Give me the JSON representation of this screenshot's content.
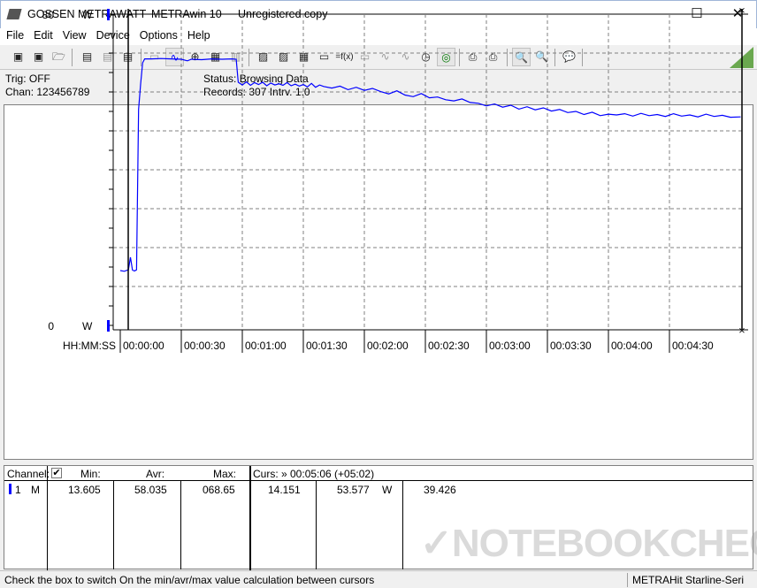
{
  "window": {
    "title_brand": "GOSSEN METRAWATT",
    "title_app": "METRAwin 10",
    "title_note": "Unregistered copy",
    "minimize": "—",
    "maximize": "☐",
    "close": "✕"
  },
  "menu": [
    "File",
    "Edit",
    "View",
    "Device",
    "Options",
    "Help"
  ],
  "toolbar": {
    "icons": [
      "save-export-icon",
      "save-icon",
      "open-folder-icon",
      "read-memory-icon",
      "read-memory-disabled-icon",
      "read-m-icon",
      "display-1257-icon",
      "waveform-icon",
      "crosshair-icon",
      "table-icon",
      "bar-graph-icon",
      "export-icon",
      "import-icon",
      "channel-config-icon",
      "monitor-icon",
      "function-icon",
      "send-icon",
      "trigger-icon",
      "sweep-icon",
      "clock-icon",
      "timer-icon",
      "print-preview-icon",
      "print-icon",
      "zoom-wave-icon",
      "zoom-icon",
      "comment-icon"
    ]
  },
  "info": {
    "trig": "Trig: OFF",
    "chan": "Chan:  123456789",
    "status": "Status:   Browsing Data",
    "records": "Records: 307   Intrv. 1.0"
  },
  "chart_data": {
    "type": "line",
    "ylim": [
      0,
      80
    ],
    "y_top_label": "80",
    "y_bottom_label": "0",
    "y_unit": "W",
    "xlabel": "HH:MM:SS",
    "xticks": [
      "00:00:00",
      "00:00:30",
      "00:01:00",
      "00:01:30",
      "00:02:00",
      "00:02:30",
      "00:03:00",
      "00:03:30",
      "00:04:00",
      "00:04:30"
    ],
    "xlim_seconds": [
      0,
      305
    ],
    "grid": true,
    "color": "#0000ff",
    "series": [
      {
        "x": [
          0,
          2,
          4,
          5,
          6,
          7,
          8,
          9,
          10,
          11,
          12,
          15,
          20,
          25,
          30,
          33,
          35,
          40,
          45,
          50,
          55,
          57,
          58,
          60,
          62,
          64,
          66,
          68,
          70,
          72,
          74,
          76,
          78,
          80,
          82,
          84,
          86,
          88,
          90,
          92,
          94,
          96,
          98,
          100,
          104,
          108,
          112,
          116,
          120,
          124,
          128,
          132,
          136,
          140,
          144,
          148,
          152,
          156,
          160,
          164,
          168,
          172,
          176,
          180,
          184,
          188,
          192,
          196,
          200,
          204,
          208,
          212,
          216,
          220,
          224,
          228,
          232,
          236,
          240,
          244,
          248,
          252,
          256,
          260,
          264,
          268,
          272,
          276,
          280,
          284,
          288,
          292,
          296,
          300,
          305
        ],
        "y": [
          14.1,
          13.9,
          14.3,
          17.5,
          14.2,
          14,
          14.3,
          55.5,
          62,
          67.5,
          68.5,
          68.5,
          68.6,
          68.5,
          68.4,
          68.0,
          68.4,
          68.3,
          68.5,
          68.4,
          68.5,
          68.4,
          62.5,
          61.8,
          62.6,
          61.7,
          62.4,
          61.9,
          62.5,
          61.6,
          62.3,
          61.8,
          62.1,
          61.7,
          62.4,
          61.6,
          62.0,
          61.5,
          61.9,
          61.3,
          62.2,
          61.2,
          61.8,
          61.4,
          61.0,
          61.5,
          60.6,
          61.2,
          60.4,
          60.9,
          60.1,
          59.5,
          60.3,
          59.2,
          58.8,
          59.6,
          58.5,
          58.7,
          58.0,
          57.7,
          58.2,
          57.3,
          57.1,
          56.4,
          56.9,
          56.1,
          56.6,
          55.6,
          56.2,
          55.4,
          55.9,
          55.1,
          55.5,
          54.7,
          55.0,
          54.2,
          54.8,
          53.9,
          54.3,
          54.1,
          54.4,
          53.8,
          54.5,
          53.9,
          54.2,
          53.7,
          54.4,
          53.8,
          54.1,
          53.6,
          54.3,
          53.7,
          54.0,
          53.5,
          53.6
        ]
      }
    ]
  },
  "table": {
    "channel_header": "Channel:",
    "checkbox_checked": true,
    "min_header": "Min:",
    "avr_header": "Avr:",
    "max_header": "Max:",
    "curs_header": "Curs: » 00:05:06 (+05:02)",
    "row": {
      "channel": "1",
      "mode": "M",
      "min": "13.605",
      "avr": "58.035",
      "max": "068.65",
      "curs1": "14.151",
      "curs2": "53.577",
      "unit": "W",
      "curs3": "39.426"
    }
  },
  "watermark": "NOTEBOOKCHECK",
  "status": {
    "hint": "Check the box to switch On the min/avr/max value calculation between cursors",
    "device": "METRAHit Starline-Seri"
  }
}
